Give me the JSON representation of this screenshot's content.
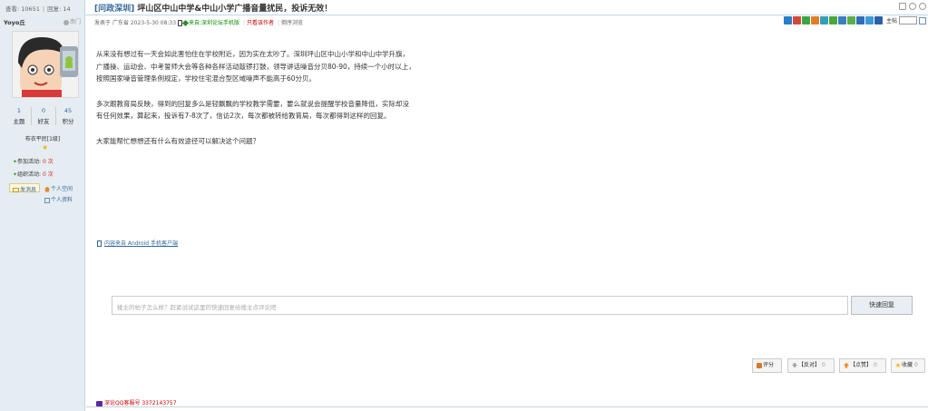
{
  "stats": {
    "views": "查看: 10651",
    "sep": "|",
    "replies": "回复: 14"
  },
  "thread": {
    "tag": "[问政深圳]",
    "title": "坪山区中山中学&中山小学广播音量扰民，投诉无效！"
  },
  "author": {
    "name": "Yoyo丘",
    "guest_label": "串门",
    "counts": [
      {
        "value": "1",
        "label": "主题"
      },
      {
        "value": "0",
        "label": "好友"
      },
      {
        "value": "45",
        "label": "积分"
      }
    ],
    "rank": "布衣平民[1级]",
    "activity_join": "参加活动:",
    "activity_join_val": "0 次",
    "activity_org": "组织活动:",
    "activity_org_val": "0 次",
    "send_msg": "发消息",
    "space": "个人空间",
    "profile": "个人资料"
  },
  "meta": {
    "posted": "发表于 广东省 2023-5-30 08:33",
    "source_prefix": "来自:",
    "source": "深圳论坛手机版",
    "only_author": "只看该作者",
    "reverse": "倒序浏览"
  },
  "toolbar": {
    "jump_label": "主帖"
  },
  "post": {
    "p1": [
      "从来没有想过有一天会如此害怕住在学校附近，因为实在太吵了。深圳坪山区中山小学和中山中学升旗，",
      "广播操、运动会、中考誓师大会等各种各样活动敲锣打鼓，领导讲话噪音分贝80-90，持续一个小时以上，",
      "按照国家噪音管理条例规定，学校住宅混合型区域噪声不能高于60分贝。"
    ],
    "p2": [
      "多次跟教育局反映，得到的回复多么是轻飘飘的学校教学需要，要么就说会提醒学校音量降低，实际却没",
      "有任何效果，算起来，投诉有7-8次了，信访2次，每次都被转给教育局，每次都得到这样的回复。"
    ],
    "p3": [
      "大家能帮忙想想还有什么有效途径可以解决这个问题？"
    ]
  },
  "source_note": "内容来自 Android 手机客户端",
  "reply": {
    "placeholder": "楼主的帖子怎么样？赶紧试试这里的快速回复给楼主点评论吧",
    "button": "快速回复"
  },
  "rating": {
    "rate": "评分",
    "against": "【反对】",
    "against_count": "0",
    "like": "【点赞】",
    "like_count": "0",
    "fav": "收藏",
    "fav_count": "0"
  },
  "footer": {
    "qq": "深论QQ客服号 3372143757"
  },
  "colors": {
    "sidebar_bg": "#e5edf2",
    "link": "#336699",
    "border": "#c2d5e3"
  }
}
